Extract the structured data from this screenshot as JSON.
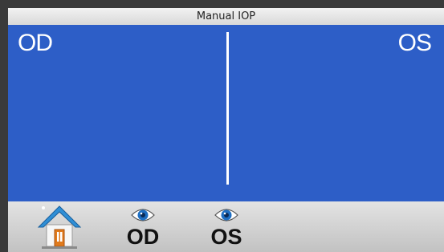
{
  "title": "Manual  IOP",
  "main": {
    "left_label": "OD",
    "right_label": "OS",
    "background": "#2d5ec7"
  },
  "toolbar": {
    "home_icon": "home-icon",
    "od_label": "OD",
    "os_label": "OS",
    "eye_icon": "eye-icon"
  }
}
